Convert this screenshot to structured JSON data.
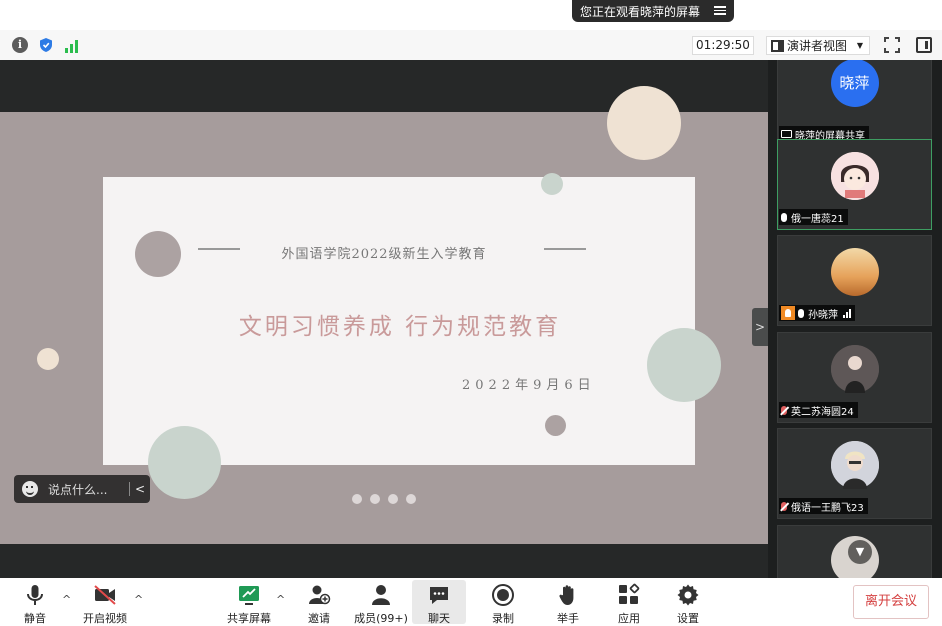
{
  "banner": {
    "text": "您正在观看晓萍的屏幕"
  },
  "topbar": {
    "timer": "01:29:50",
    "view_mode": "演讲者视图"
  },
  "slide": {
    "subtitle": "外国语学院2022级新生入学教育",
    "title": "文明习惯养成 行为规范教育",
    "date": "2022年9月6日",
    "colors": {
      "background": "#a69c9c",
      "card": "#f5f3f3",
      "title": "#c99a9a",
      "sage": "#c9d4cd",
      "taupe": "#aca2a2",
      "cream": "#efe2d3"
    }
  },
  "chat": {
    "placeholder": "说点什么..."
  },
  "participants": [
    {
      "avatar_text": "晓萍",
      "label": "晓萍的屏幕共享"
    },
    {
      "label": "俄一唐蕊21"
    },
    {
      "label": "孙晓萍"
    },
    {
      "label": "英二苏海圆24"
    },
    {
      "label": "俄语一王鹏飞23"
    }
  ],
  "toolbar": {
    "mute": "静音",
    "video": "开启视频",
    "share": "共享屏幕",
    "invite": "邀请",
    "members": "成员(99+)",
    "chat": "聊天",
    "record": "录制",
    "raise_hand": "举手",
    "apps": "应用",
    "settings": "设置",
    "leave": "离开会议"
  }
}
